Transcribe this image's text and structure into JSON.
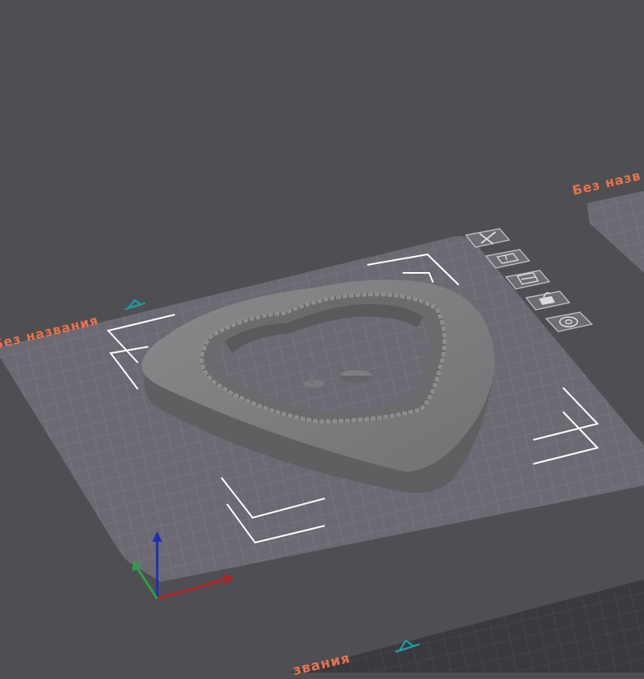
{
  "viewport": {
    "background": "#4f4e53",
    "plates": [
      {
        "name": "main",
        "label": "Без названия",
        "state": "selected"
      },
      {
        "name": "right",
        "label": "Без назв",
        "state": "partially-visible"
      },
      {
        "name": "bottom",
        "label": "звания",
        "state": "partially-visible"
      }
    ],
    "plate_toolbar": [
      "close-icon",
      "arrange-icon",
      "orient-icon",
      "lock-icon",
      "settings-icon"
    ],
    "axes": {
      "x": "#b22222",
      "y": "#2ea043",
      "z": "#1e2fb8"
    },
    "colors": {
      "label": "#e8734a",
      "edit": "#1e9aa6",
      "plate": "#6b6a72",
      "grid": "#85848c",
      "model": "#7c7c7e"
    },
    "model": {
      "shape": "heart-frame"
    }
  }
}
